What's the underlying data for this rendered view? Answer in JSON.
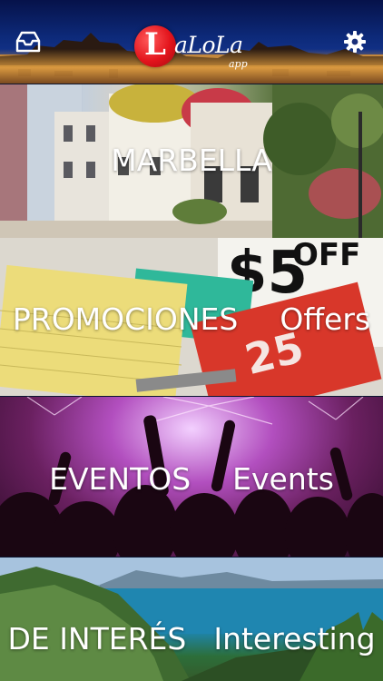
{
  "header": {
    "logo_letter": "L",
    "logo_word": "aLoLa",
    "logo_sub": "app",
    "mail_icon": "mail-tray-icon",
    "settings_icon": "gear-icon"
  },
  "categories": [
    {
      "es": "MARBELLA",
      "en": ""
    },
    {
      "es": "PROMOCIONES",
      "en": "Offers"
    },
    {
      "es": "EVENTOS",
      "en": "Events"
    },
    {
      "es": "DE INTERÉS",
      "en": "Interesting"
    }
  ],
  "colors": {
    "header_blue": "#0d2a7a",
    "logo_red": "#e3141c",
    "text": "#ffffff"
  }
}
